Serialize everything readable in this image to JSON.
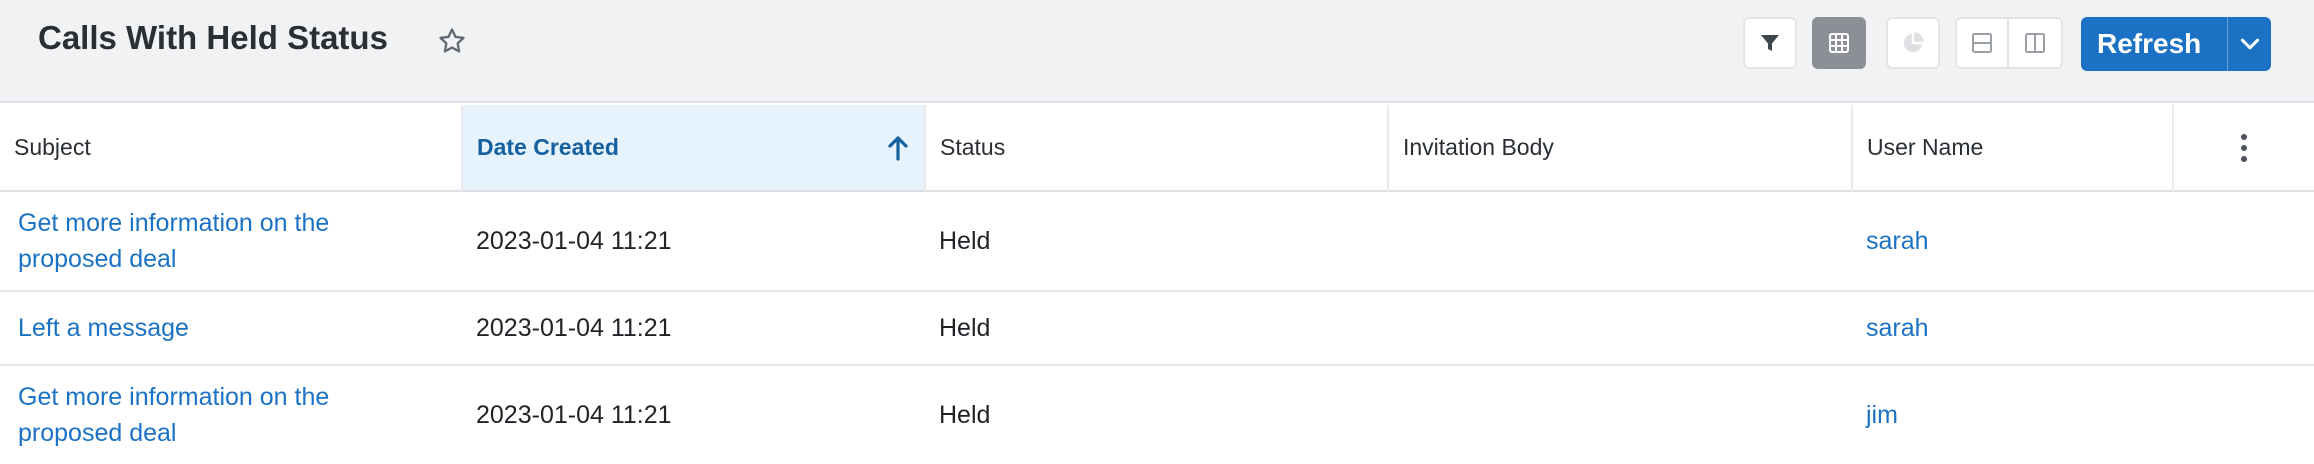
{
  "header": {
    "title": "Calls With Held Status",
    "star_icon": "star-outline-icon",
    "tools": [
      {
        "name": "filter",
        "icon": "filter-icon"
      },
      {
        "name": "table-view",
        "icon": "grid-icon",
        "active": true
      },
      {
        "name": "chart-view",
        "icon": "pie-chart-icon",
        "disabled": true
      },
      {
        "name": "split-horizontal",
        "icon": "split-horizontal-icon"
      },
      {
        "name": "split-vertical",
        "icon": "split-vertical-icon"
      }
    ],
    "refresh_label": "Refresh",
    "refresh_dropdown_icon": "chevron-down-icon"
  },
  "colors": {
    "accent": "#1b72c4",
    "sorted_header_bg": "#e6f3fc",
    "header_bg": "#f1f2f4"
  },
  "table": {
    "columns": [
      {
        "label": "Subject"
      },
      {
        "label": "Date Created",
        "sorted": "ascending"
      },
      {
        "label": "Status"
      },
      {
        "label": "Invitation Body"
      },
      {
        "label": "User Name"
      }
    ],
    "column_menu_icon": "kebab-menu-icon",
    "rows": [
      {
        "subject": "Get more information on the proposed deal",
        "date_created": "2023-01-04 11:21",
        "status": "Held",
        "invitation_body": "",
        "user_name": "sarah"
      },
      {
        "subject": "Left a message",
        "date_created": "2023-01-04 11:21",
        "status": "Held",
        "invitation_body": "",
        "user_name": "sarah"
      },
      {
        "subject": "Get more information on the proposed deal",
        "date_created": "2023-01-04 11:21",
        "status": "Held",
        "invitation_body": "",
        "user_name": "jim"
      }
    ]
  }
}
